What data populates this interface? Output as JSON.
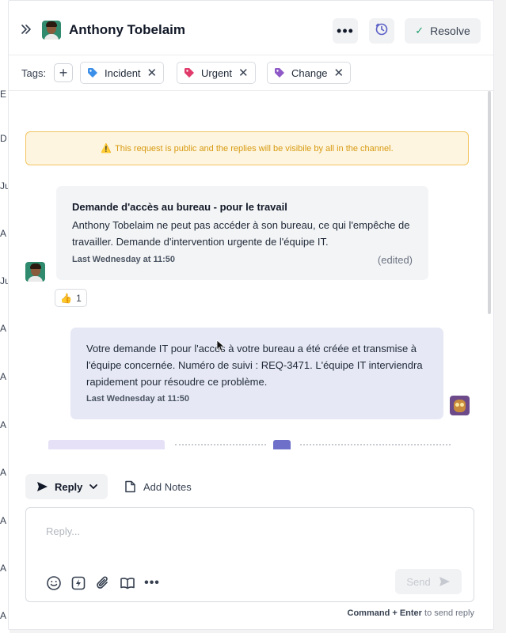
{
  "left_strip": {
    "letters": [
      "E",
      "D",
      "Ju",
      "A",
      "Ju",
      "A",
      "A",
      "A",
      "A",
      "A",
      "A",
      "A"
    ]
  },
  "header": {
    "title": "Anthony Tobelaim",
    "more_label": "•••",
    "resolve_label": "Resolve"
  },
  "tags": {
    "label": "Tags:",
    "items": [
      {
        "name": "Incident",
        "color": "#3b8fe8"
      },
      {
        "name": "Urgent",
        "color": "#e03b6a"
      },
      {
        "name": "Change",
        "color": "#8f5ac7"
      }
    ]
  },
  "notice": {
    "text": "This request is public and the replies will be visibile by all in the channel."
  },
  "messages": {
    "incoming": {
      "title": "Demande d'accès au bureau - pour le travail",
      "body": "Anthony Tobelaim ne peut pas accéder à son bureau, ce qui l'empêche de travailler. Demande d'intervention urgente de l'équipe IT.",
      "timestamp": "Last Wednesday at 11:50",
      "edited": "(edited)",
      "reaction": {
        "emoji": "👍",
        "count": "1"
      }
    },
    "outgoing": {
      "body": "Votre demande IT pour l'accès à votre bureau a été créée et transmise à l'équipe concernée. Numéro de suivi : REQ-3471. L'équipe IT interviendra rapidement pour résoudre ce problème.",
      "timestamp": "Last Wednesday at 11:50"
    }
  },
  "composer": {
    "reply_tab": "Reply",
    "notes_tab": "Add Notes",
    "placeholder": "Reply...",
    "send_label": "Send",
    "hint_keys": "Command + Enter",
    "hint_text": " to send reply"
  },
  "colors": {
    "notice_bg": "#fdf5df",
    "notice_border": "#f2c562",
    "notice_text": "#d89a12",
    "outgoing_bubble": "#e6e8f5",
    "incoming_bubble": "#f3f4f6",
    "resolve_check": "#1f9d6b"
  }
}
